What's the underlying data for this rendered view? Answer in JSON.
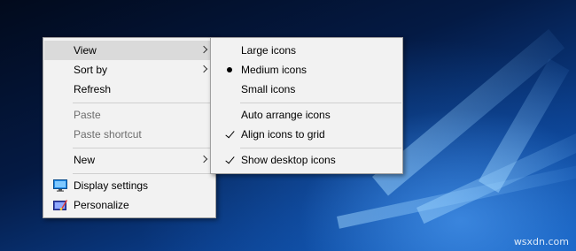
{
  "context_menu": {
    "items": {
      "view": "View",
      "sort_by": "Sort by",
      "refresh": "Refresh",
      "paste": "Paste",
      "paste_shortcut": "Paste shortcut",
      "new": "New",
      "display_settings": "Display settings",
      "personalize": "Personalize"
    }
  },
  "view_submenu": {
    "large_icons": "Large icons",
    "medium_icons": "Medium icons",
    "small_icons": "Small icons",
    "auto_arrange": "Auto arrange icons",
    "align_to_grid": "Align icons to grid",
    "show_desktop_icons": "Show desktop icons",
    "selected": "Medium icons",
    "checked": [
      "Align icons to grid",
      "Show desktop icons"
    ]
  },
  "icons": {
    "display_settings": "monitor-icon",
    "personalize": "paintbrush-icon",
    "submenu": "chevron-right-icon",
    "radio": "bullet-icon",
    "checked": "checkmark-icon"
  },
  "colors": {
    "menu_bg": "#f2f2f2",
    "hover_bg": "#dadada",
    "disabled_text": "#6d6d6d",
    "desktop_dark": "#041a44",
    "desktop_light": "#0f5cbf"
  },
  "watermark": "wsxdn.com"
}
